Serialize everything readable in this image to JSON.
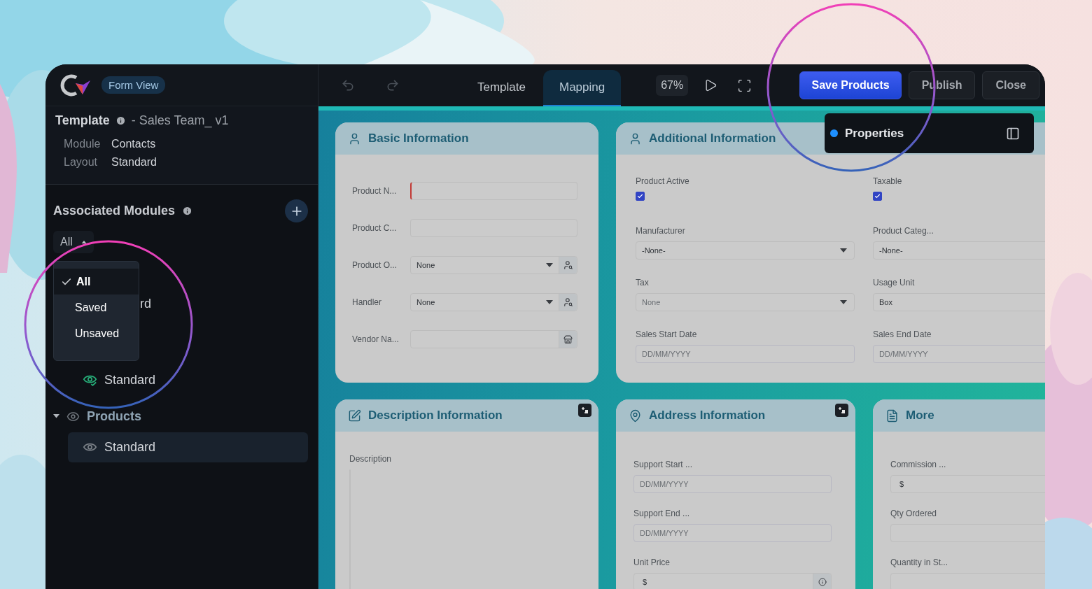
{
  "app": {
    "badge": "Form View"
  },
  "template": {
    "label": "Template",
    "name": "- Sales Team_ v1",
    "meta": [
      {
        "label": "Module",
        "value": "Contacts"
      },
      {
        "label": "Layout",
        "value": "Standard"
      }
    ]
  },
  "modules": {
    "title": "Associated Modules",
    "filter": {
      "value": "All",
      "expanded": true,
      "options": [
        {
          "label": "All",
          "selected": true
        },
        {
          "label": "Saved",
          "selected": false
        },
        {
          "label": "Unsaved",
          "selected": false
        }
      ]
    },
    "tree": [
      {
        "label": "rd",
        "kind": "partial"
      },
      {
        "label": "Standard",
        "kind": "layout",
        "verified": true,
        "selected": false
      },
      {
        "label": "Products",
        "kind": "module",
        "expanded": true,
        "children": [
          {
            "label": "Standard",
            "kind": "layout",
            "verified": false,
            "selected": true
          }
        ]
      }
    ]
  },
  "toolbar": {
    "tabs": [
      {
        "label": "Template",
        "selected": false
      },
      {
        "label": "Mapping",
        "selected": true
      }
    ],
    "zoom": "67%",
    "actions": [
      {
        "label": "Save Products",
        "kind": "primary"
      },
      {
        "label": "Publish",
        "kind": "secondary"
      },
      {
        "label": "Close",
        "kind": "secondary"
      }
    ]
  },
  "properties": {
    "title": "Properties"
  },
  "section_rows": [
    {
      "cards": [
        {
          "title": "Basic Information",
          "action": false,
          "fields": [
            {
              "label": "Product N...",
              "kind": "text",
              "required": true
            },
            {
              "label": "Product C...",
              "kind": "text",
              "required": false
            },
            {
              "label": "Product O...",
              "kind": "lookup",
              "value": "None"
            },
            {
              "label": "Handler",
              "kind": "lookup",
              "value": "None"
            },
            {
              "label": "Vendor Na...",
              "kind": "store_lookup"
            }
          ]
        },
        {
          "title": "Additional Information",
          "action": false,
          "fields": [
            {
              "label": "Product Active",
              "kind": "checkbox",
              "checked": true
            },
            {
              "label": "Taxable",
              "kind": "checkbox",
              "checked": true
            },
            {
              "label": "Manufacturer",
              "kind": "select",
              "value": "-None-",
              "muted": false
            },
            {
              "label": "Product Categ...",
              "kind": "select",
              "value": "-None-",
              "muted": false
            },
            {
              "label": "Tax",
              "kind": "select",
              "value": "None",
              "muted": true
            },
            {
              "label": "Usage Unit",
              "kind": "text",
              "value": "Box",
              "required": false
            },
            {
              "label": "Sales Start Date",
              "kind": "date",
              "placeholder": "DD/MM/YYYY"
            },
            {
              "label": "Sales End Date",
              "kind": "date",
              "placeholder": "DD/MM/YYYY"
            }
          ]
        }
      ]
    },
    {
      "cards": [
        {
          "title": "Description Information",
          "action": true,
          "fields": [
            {
              "label": "Description",
              "kind": "textarea"
            }
          ]
        },
        {
          "title": "Address Information",
          "action": true,
          "fields": [
            {
              "label": "Support Start ...",
              "kind": "date",
              "placeholder": "DD/MM/YYYY"
            },
            {
              "label": "Support End ...",
              "kind": "date",
              "placeholder": "DD/MM/YYYY"
            },
            {
              "label": "Unit Price",
              "kind": "currency",
              "symbol": "$",
              "info": true
            }
          ]
        },
        {
          "title": "More",
          "fields": [
            {
              "label": "Commission ...",
              "kind": "currency",
              "symbol": "$"
            },
            {
              "label": "Qty Ordered",
              "kind": "text",
              "required": false
            },
            {
              "label": "Quantity in St...",
              "kind": "text",
              "required": false
            }
          ]
        }
      ]
    }
  ]
}
